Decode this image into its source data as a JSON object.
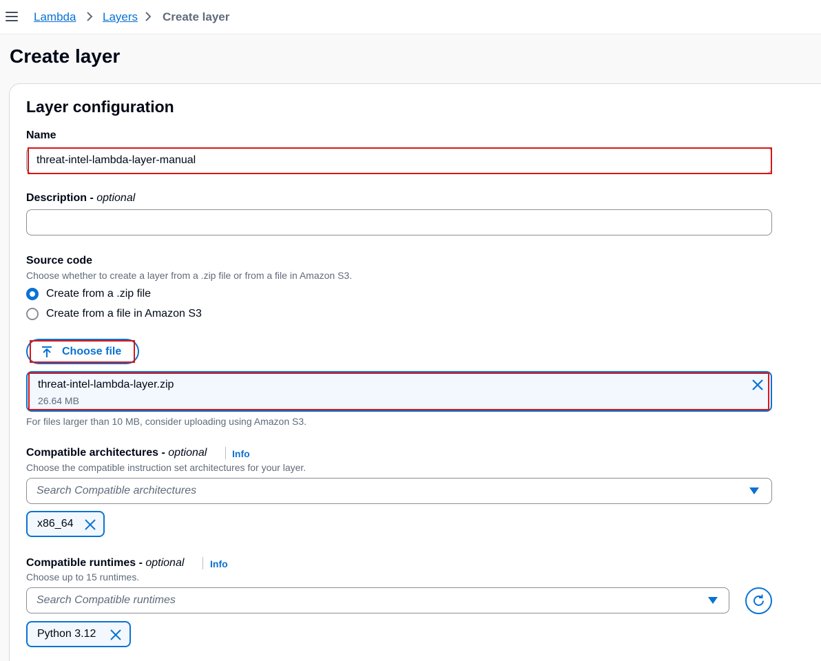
{
  "breadcrumb": {
    "items": [
      {
        "label": "Lambda"
      },
      {
        "label": "Layers"
      },
      {
        "label": "Create layer"
      }
    ]
  },
  "page": {
    "title": "Create layer"
  },
  "layer_config": {
    "title": "Layer configuration",
    "name_label": "Name",
    "name_value": "threat-intel-lambda-layer-manual",
    "description_label": "Description - ",
    "description_optional": "optional",
    "description_value": "",
    "source_code": {
      "label": "Source code",
      "hint": "Choose whether to create a layer from a .zip file or from a file in Amazon S3.",
      "options": [
        {
          "label": "Create from a .zip file",
          "selected": true
        },
        {
          "label": "Create from a file in Amazon S3",
          "selected": false
        }
      ]
    },
    "choose_file_label": "Choose file",
    "file": {
      "name": "threat-intel-lambda-layer.zip",
      "size": "26.64 MB"
    },
    "file_hint": "For files larger than 10 MB, consider uploading using Amazon S3.",
    "architectures": {
      "label": "Compatible architectures - ",
      "optional": "optional",
      "info": "Info",
      "hint": "Choose the compatible instruction set architectures for your layer.",
      "placeholder": "Search Compatible architectures",
      "tokens": [
        "x86_64"
      ]
    },
    "runtimes": {
      "label": "Compatible runtimes - ",
      "optional": "optional",
      "info": "Info",
      "hint": "Choose up to 15 runtimes.",
      "placeholder": "Search Compatible runtimes",
      "tokens": [
        "Python 3.12"
      ]
    }
  },
  "colors": {
    "accent": "#0972d3",
    "highlight": "#d91515",
    "text": "#000716",
    "muted": "#5f6b7a"
  }
}
